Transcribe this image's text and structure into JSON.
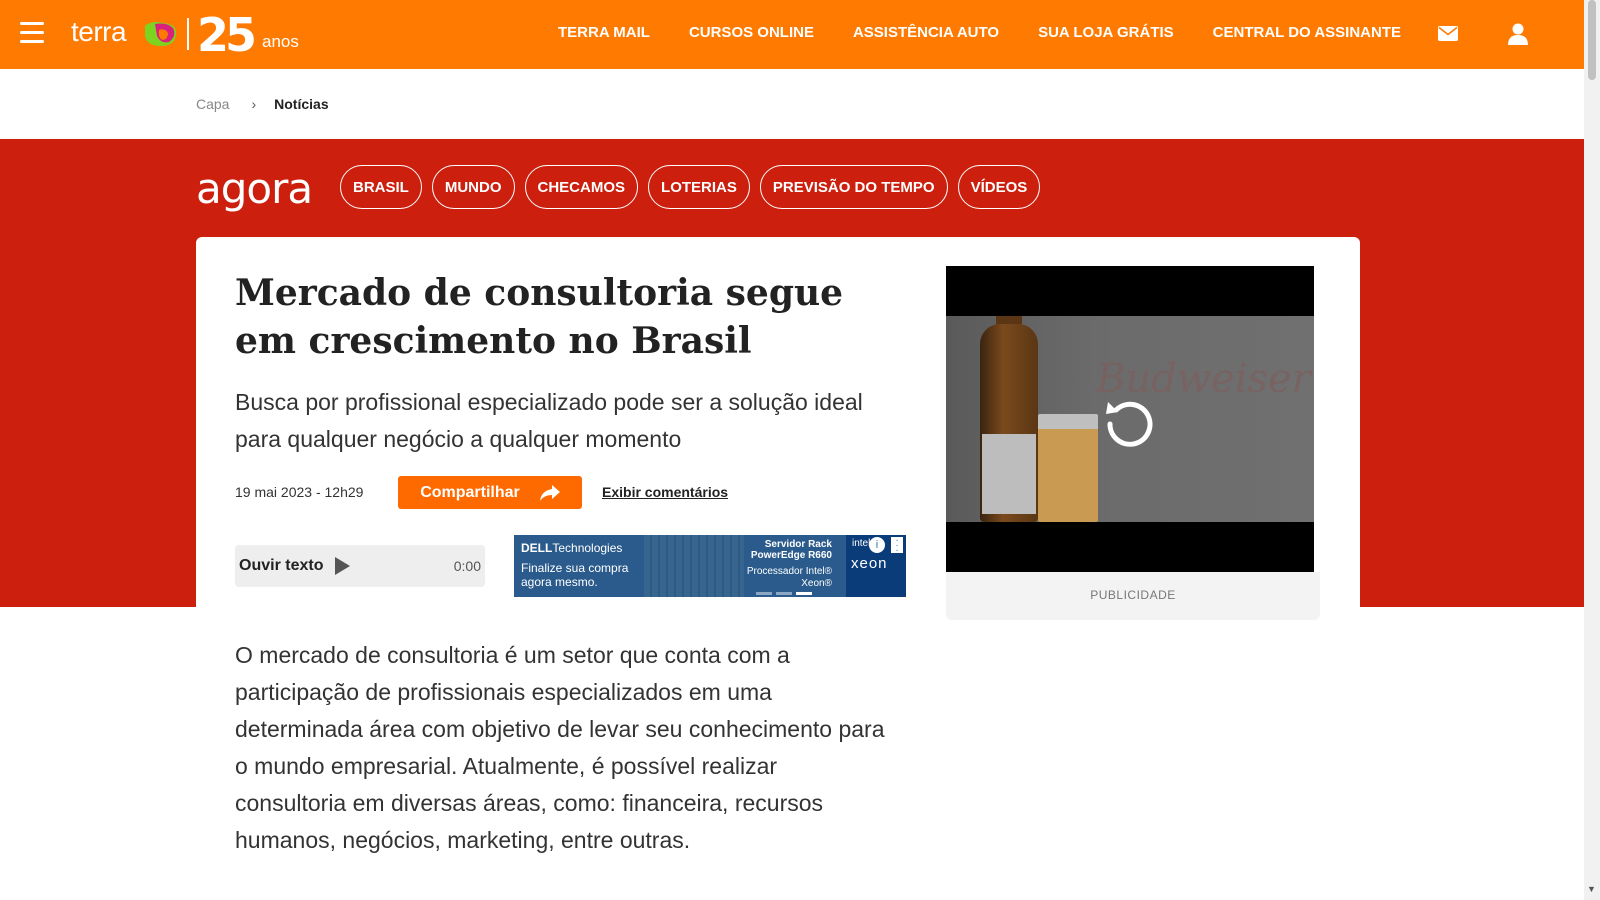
{
  "header": {
    "brand": "terra",
    "anniversary_number": "25",
    "anniversary_label": "anos",
    "nav": [
      "TERRA MAIL",
      "CURSOS ONLINE",
      "ASSISTÊNCIA AUTO",
      "SUA LOJA GRÁTIS",
      "CENTRAL DO ASSINANTE"
    ],
    "icons": [
      "menu-icon",
      "mail-icon",
      "user-icon"
    ],
    "background_color": "#ff7a00"
  },
  "breadcrumb": {
    "home": "Capa",
    "separator": "›",
    "current": "Notícias"
  },
  "section": {
    "logo": "agora",
    "background_color": "#cc1f0e",
    "pills": [
      "BRASIL",
      "MUNDO",
      "CHECAMOS",
      "LOTERIAS",
      "PREVISÃO DO TEMPO",
      "VÍDEOS"
    ]
  },
  "article": {
    "title": "Mercado de consultoria segue em crescimento no Brasil",
    "subtitle": "Busca por profissional especializado pode ser a solução ideal para qualquer negócio a qualquer momento",
    "date": "19 mai 2023 - 12h29",
    "share_label": "Compartilhar",
    "comments_label": "Exibir comentários",
    "audio": {
      "label": "Ouvir texto",
      "time": "0:00"
    },
    "body": "O mercado de consultoria é um setor que conta com a participação de profissionais especializados em uma determinada área com objetivo de levar seu conhecimento para o mundo empresarial. Atualmente, é possível realizar consultoria em diversas áreas, como: financeira, recursos humanos, negócios, marketing, entre outras."
  },
  "ad_banner": {
    "brand_bold": "DELL",
    "brand_rest": "Technologies",
    "cta": "Finalize sua compra agora mesmo.",
    "product": "Servidor Rack PowerEdge R660",
    "processor": "Processador Intel® Xeon®",
    "chip_brand": "intel",
    "chip_name": "xeon"
  },
  "video_ad": {
    "brand_text": "Budweiser",
    "label": "PUBLICIDADE"
  }
}
